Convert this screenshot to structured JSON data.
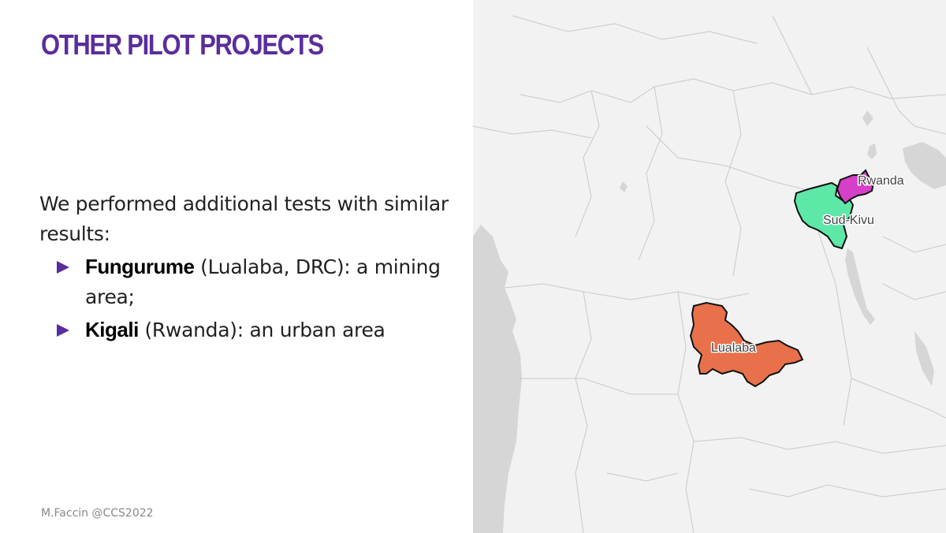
{
  "slide": {
    "title": "OTHER PILOT PROJECTS",
    "intro": "We performed additional tests with similar results:",
    "bullets": [
      {
        "keyword": "Fungurume",
        "detail": " (Lualaba, DRC): a mining area;"
      },
      {
        "keyword": "Kigali",
        "detail": " (Rwanda): an urban area"
      }
    ],
    "footer": "M.Faccin @CCS2022"
  },
  "map": {
    "regions": [
      {
        "name": "Rwanda",
        "color": "#d63fc8"
      },
      {
        "name": "Sud-Kivu",
        "color": "#5ee8a8"
      },
      {
        "name": "Lualaba",
        "color": "#e8704a"
      }
    ],
    "water_color": "#d6d6d6",
    "land_color": "#f2f2f2",
    "border_color": "#c9c9c9"
  },
  "colors": {
    "accent": "#5a2d9c"
  }
}
